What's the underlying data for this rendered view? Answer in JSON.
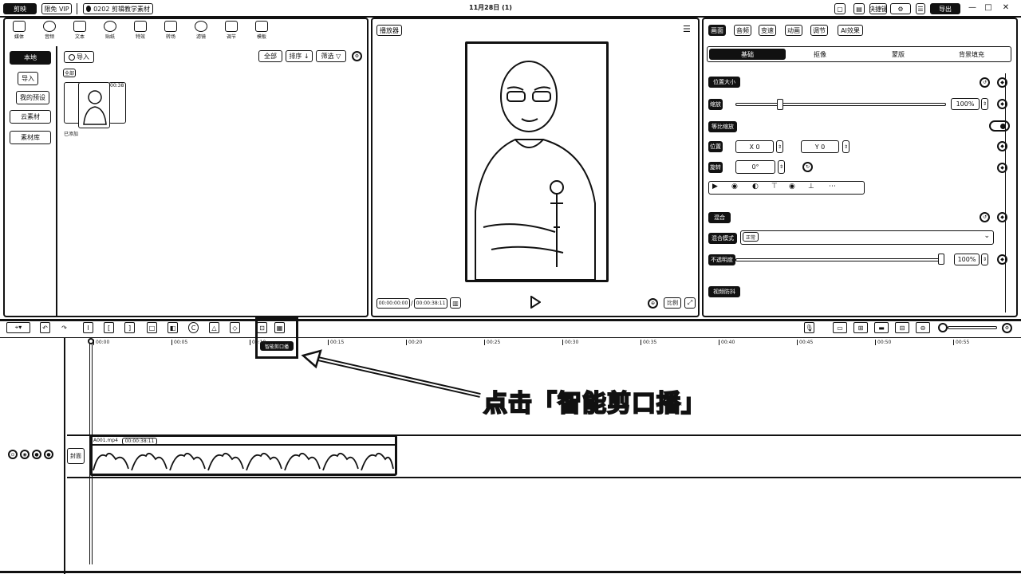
{
  "titlebar": {
    "logo": "剪映",
    "member_badge": "限免 VIP",
    "project_name": "0202 剪辑教学素材",
    "date_label": "11月28日 (1)",
    "window_buttons": [
      "—",
      "□",
      "✕"
    ],
    "right_items": [
      "快捷键",
      "导出"
    ]
  },
  "media_panel": {
    "tools": [
      {
        "label": "媒体",
        "icon": "media-icon"
      },
      {
        "label": "音频",
        "icon": "audio-icon"
      },
      {
        "label": "文本",
        "icon": "text-icon"
      },
      {
        "label": "贴纸",
        "icon": "sticker-icon"
      },
      {
        "label": "特效",
        "icon": "effect-icon"
      },
      {
        "label": "转场",
        "icon": "transition-icon"
      },
      {
        "label": "滤镜",
        "icon": "filter-icon"
      },
      {
        "label": "调节",
        "icon": "adjust-icon"
      },
      {
        "label": "模板",
        "icon": "template-icon"
      }
    ],
    "sidebar": [
      "本地",
      "导入",
      "我的预设",
      "云素材",
      "素材库"
    ],
    "import_label": "导入",
    "filter_buttons": [
      "全部",
      "排序 ↓",
      "筛选 ▽"
    ],
    "tag": "全部",
    "clip_duration": "00:38",
    "clip_status": "已添加"
  },
  "player": {
    "title": "播放器",
    "current_time": "00:00:00:00",
    "total_time": "00:00:38:11",
    "ratio_label": "比例",
    "play_icon": "play-icon"
  },
  "properties": {
    "tabs": [
      "画面",
      "音频",
      "变速",
      "动画",
      "调节",
      "AI效果"
    ],
    "subtabs": [
      "基础",
      "抠像",
      "蒙版",
      "背景填充"
    ],
    "sections": {
      "position_size": "位置大小",
      "scale_label": "缩放",
      "scale_value": "100%",
      "uniform_scale": "等比缩放",
      "position_label": "位置",
      "pos_x": "X  0",
      "pos_y": "Y  0",
      "rotate_label": "旋转",
      "rotate_value": "0°",
      "blend": "混合",
      "blend_mode_label": "混合模式",
      "blend_mode_value": "正常",
      "opacity_label": "不透明度",
      "opacity_value": "100%",
      "stabilize": "视频防抖"
    }
  },
  "timeline": {
    "toolbar_buttons": [
      "选择",
      "撤销",
      "重做",
      "分割",
      "向左裁剪",
      "向右裁剪",
      "删除",
      "定格",
      "倒放",
      "镜像",
      "旋转",
      "裁剪",
      "智能剪口播"
    ],
    "smart_cut_label": "智能剪口播",
    "ticks": [
      "00:00",
      "00:05",
      "00:10",
      "00:15",
      "00:20",
      "00:25",
      "00:30",
      "00:35",
      "00:40",
      "00:45",
      "00:50",
      "00:55"
    ],
    "track_label": "封面",
    "clip_title": "A001.mp4",
    "clip_duration": "00:00:38:11"
  },
  "annotation": {
    "text": "点击「智能剪口播」"
  }
}
